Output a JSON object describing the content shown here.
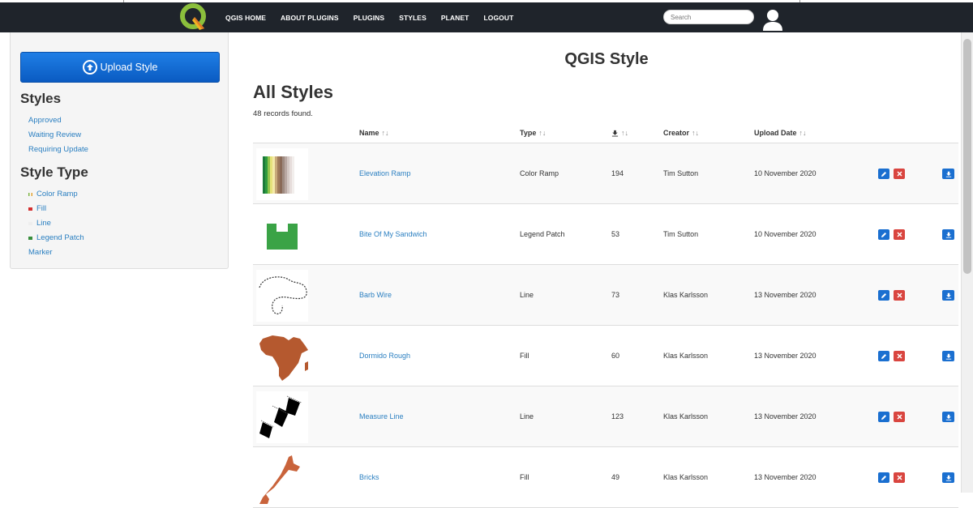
{
  "nav": {
    "links": [
      "QGIS HOME",
      "ABOUT PLUGINS",
      "PLUGINS",
      "STYLES",
      "PLANET",
      "LOGOUT"
    ],
    "search_placeholder": "Search"
  },
  "sidebar": {
    "upload_label": "Upload Style",
    "styles_heading": "Styles",
    "style_links": [
      "Approved",
      "Waiting Review",
      "Requiring Update"
    ],
    "type_heading": "Style Type",
    "types": [
      {
        "label": "Color Ramp",
        "color": "#7cb342"
      },
      {
        "label": "Fill",
        "color": "#d32f2f"
      },
      {
        "label": "Line",
        "color": "#eeeeee"
      },
      {
        "label": "Legend Patch",
        "color": "#388e3c"
      },
      {
        "label": "Marker",
        "color": ""
      }
    ]
  },
  "main": {
    "page_title": "QGIS Style",
    "section_title": "All Styles",
    "records": "48 records found.",
    "headers": {
      "name": "Name",
      "type": "Type",
      "creator": "Creator",
      "upload_date": "Upload Date"
    },
    "rows": [
      {
        "name": "Elevation Ramp",
        "type": "Color Ramp",
        "downloads": "194",
        "creator": "Tim Sutton",
        "date": "10 November 2020"
      },
      {
        "name": "Bite Of My Sandwich",
        "type": "Legend Patch",
        "downloads": "53",
        "creator": "Tim Sutton",
        "date": "10 November 2020"
      },
      {
        "name": "Barb Wire",
        "type": "Line",
        "downloads": "73",
        "creator": "Klas Karlsson",
        "date": "13 November 2020"
      },
      {
        "name": "Dormido Rough",
        "type": "Fill",
        "downloads": "60",
        "creator": "Klas Karlsson",
        "date": "13 November 2020"
      },
      {
        "name": "Measure Line",
        "type": "Line",
        "downloads": "123",
        "creator": "Klas Karlsson",
        "date": "13 November 2020"
      },
      {
        "name": "Bricks",
        "type": "Fill",
        "downloads": "49",
        "creator": "Klas Karlsson",
        "date": "13 November 2020"
      }
    ]
  },
  "colors": {
    "navbar": "#1f242b",
    "link": "#2a7fc1",
    "edit": "#1a6fd0",
    "delete": "#d9453f"
  }
}
